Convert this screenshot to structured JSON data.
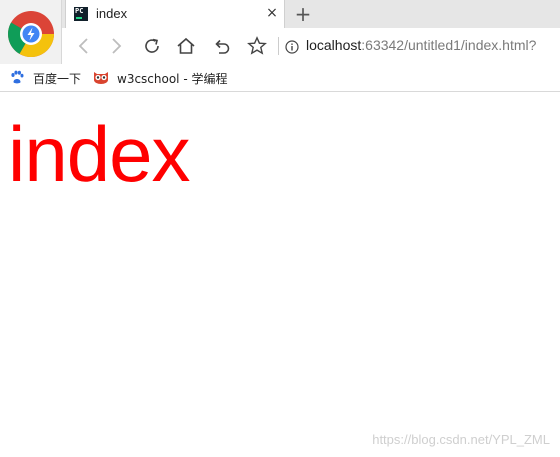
{
  "tab": {
    "favicon_text": "PC",
    "title": "index",
    "close_glyph": "×",
    "new_tab_glyph": "+"
  },
  "address": {
    "host": "localhost",
    "rest": ":63342/untitled1/index.html?"
  },
  "bookmarks": [
    {
      "label": "百度一下"
    },
    {
      "label": "w3cschool - 学编程"
    }
  ],
  "page": {
    "heading": "index",
    "heading_color": "#ff0000"
  },
  "watermark": "https://blog.csdn.net/YPL_ZML",
  "icons": {
    "browser_logo": "browser-logo-icon",
    "back": "back-arrow-icon",
    "forward": "forward-arrow-icon",
    "reload": "reload-icon",
    "home": "home-icon",
    "undo": "undo-icon",
    "star": "star-icon",
    "info": "info-icon",
    "baidu": "paw-icon",
    "w3cschool": "owl-icon"
  }
}
